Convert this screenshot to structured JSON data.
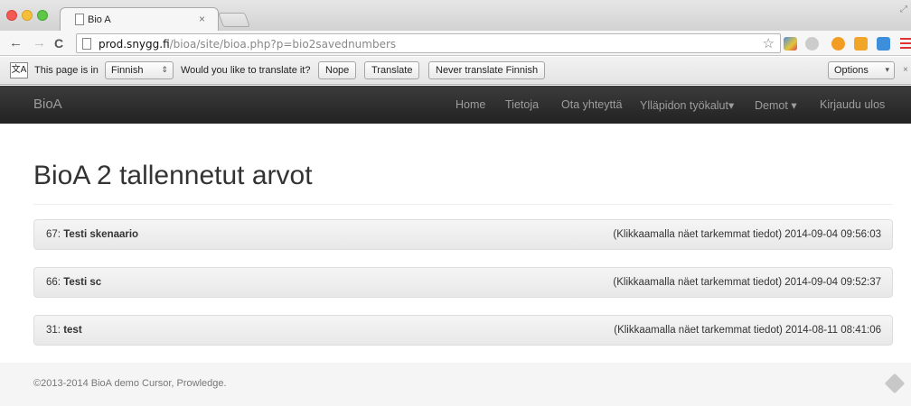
{
  "browser": {
    "tab_title": "Bio A",
    "tab_close": "×",
    "url_host": "prod.snygg.fi",
    "url_path": "/bioa/site/bioa.php?p=bio2savednumbers",
    "back": "←",
    "forward": "→",
    "reload": "C",
    "star": "☆"
  },
  "translate_bar": {
    "icon": "文A",
    "intro": "This page is in",
    "language": "Finnish",
    "question": "Would you like to translate it?",
    "nope": "Nope",
    "translate": "Translate",
    "never": "Never translate Finnish",
    "options": "Options",
    "close": "×"
  },
  "navbar": {
    "brand": "BioA",
    "items": [
      "Home",
      "Tietoja",
      "Ota yhteyttä",
      "Ylläpidon työkalut",
      "Demot",
      "Kirjaudu ulos"
    ],
    "caret": "▾"
  },
  "main": {
    "title": "BioA 2 tallennetut arvot",
    "records": [
      {
        "id": "67:",
        "name": "Testi skenaario",
        "info": "(Klikkaamalla näet tarkemmat tiedot) 2014-09-04 09:56:03"
      },
      {
        "id": "66:",
        "name": "Testi sc",
        "info": "(Klikkaamalla näet tarkemmat tiedot) 2014-09-04 09:52:37"
      },
      {
        "id": "31:",
        "name": "test",
        "info": "(Klikkaamalla näet tarkemmat tiedot) 2014-08-11 08:41:06"
      }
    ]
  },
  "footer": {
    "text": "©2013-2014 BioA demo Cursor, Prowledge."
  },
  "colors": {
    "navbar_bg": "#222222",
    "navbar_text": "#9d9d9d",
    "panel_bg": "#f5f5f5",
    "footer_bg": "#f5f5f5"
  }
}
